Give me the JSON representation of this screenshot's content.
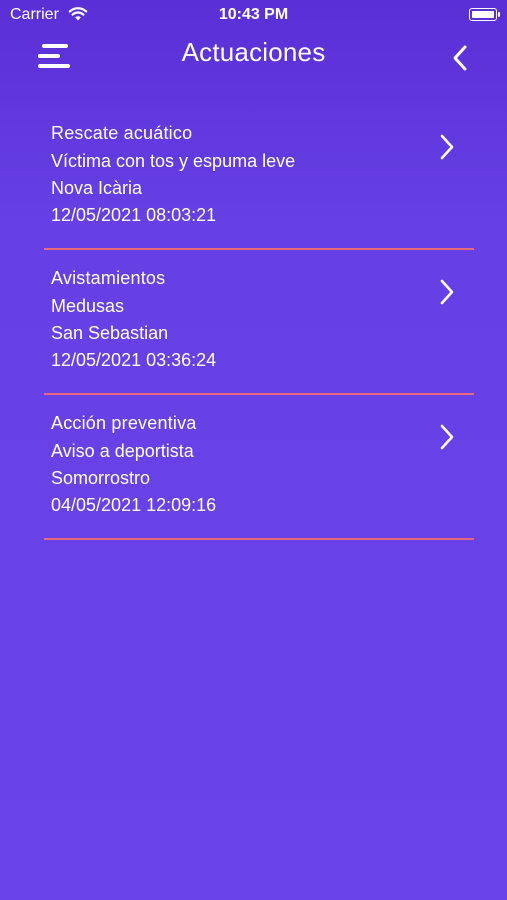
{
  "status_bar": {
    "carrier": "Carrier",
    "time": "10:43 PM"
  },
  "header": {
    "title": "Actuaciones",
    "menu_icon": "hamburger-menu-icon",
    "back_icon": "chevron-left-icon"
  },
  "items": [
    {
      "title": "Rescate acuático",
      "detail": "Víctima con tos y espuma leve",
      "location": "Nova Icària",
      "datetime": "12/05/2021 08:03:21"
    },
    {
      "title": "Avistamientos",
      "detail": "Medusas",
      "location": "San Sebastian",
      "datetime": "12/05/2021 03:36:24"
    },
    {
      "title": "Acción preventiva",
      "detail": "Aviso a deportista",
      "location": "Somorrostro",
      "datetime": "04/05/2021 12:09:16"
    }
  ],
  "colors": {
    "background": "#6742e6",
    "divider": "#e86a7a",
    "text": "#ffffff"
  }
}
